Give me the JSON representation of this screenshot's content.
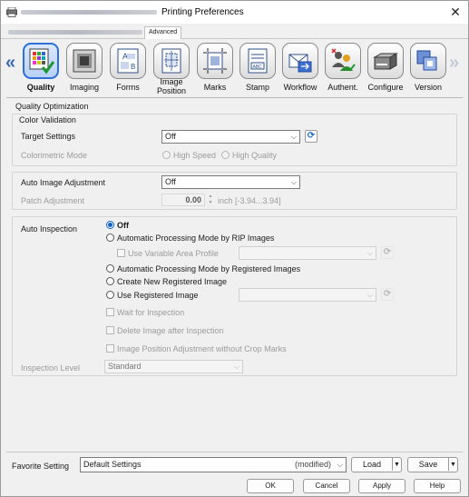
{
  "window": {
    "title": "Printing Preferences",
    "tab": "Advanced"
  },
  "toolbar": {
    "items": [
      {
        "label": "Quality",
        "icon": "quality-grid-icon"
      },
      {
        "label": "Imaging",
        "icon": "imaging-icon"
      },
      {
        "label": "Forms",
        "icon": "forms-icon"
      },
      {
        "label": "Image Position",
        "icon": "image-position-icon"
      },
      {
        "label": "Marks",
        "icon": "marks-icon"
      },
      {
        "label": "Stamp",
        "icon": "stamp-icon"
      },
      {
        "label": "Workflow",
        "icon": "workflow-icon"
      },
      {
        "label": "Authent.",
        "icon": "authentication-icon"
      },
      {
        "label": "Configure",
        "icon": "configure-printer-icon"
      },
      {
        "label": "Version",
        "icon": "version-icon"
      }
    ],
    "active": "Quality"
  },
  "content": {
    "section_title": "Quality Optimization",
    "color_validation": {
      "title": "Color Validation",
      "target_settings_label": "Target Settings",
      "target_settings_value": "Off",
      "colorimetric_mode_label": "Colorimetric Mode",
      "colorimetric_options": [
        "High Speed",
        "High Quality"
      ],
      "colorimetric_selected": "High Speed"
    },
    "auto_image": {
      "label": "Auto Image Adjustment",
      "value": "Off",
      "patch_label": "Patch Adjustment",
      "patch_value": "0.00",
      "patch_unit": "inch [-3.94...3.94]"
    },
    "auto_inspection": {
      "label": "Auto Inspection",
      "options": [
        "Off",
        "Automatic Processing Mode by RIP Images",
        "Automatic Processing Mode by Registered Images",
        "Create New Registered Image",
        "Use Registered Image"
      ],
      "selected": "Off",
      "use_variable_area_profile": "Use Variable Area Profile",
      "wait_for_inspection": "Wait for Inspection",
      "delete_image_after_inspection": "Delete Image after Inspection",
      "image_position_adjustment": "Image Position Adjustment without Crop Marks",
      "inspection_level_label": "Inspection Level",
      "inspection_level_value": "Standard"
    }
  },
  "favorite": {
    "label": "Favorite Setting",
    "value": "Default Settings",
    "modified": "(modified)",
    "load": "Load",
    "save": "Save"
  },
  "buttons": {
    "ok": "OK",
    "cancel": "Cancel",
    "apply": "Apply",
    "help": "Help"
  },
  "colors": {
    "accent": "#1060c8",
    "active_tab_border": "#2f6fd8"
  }
}
